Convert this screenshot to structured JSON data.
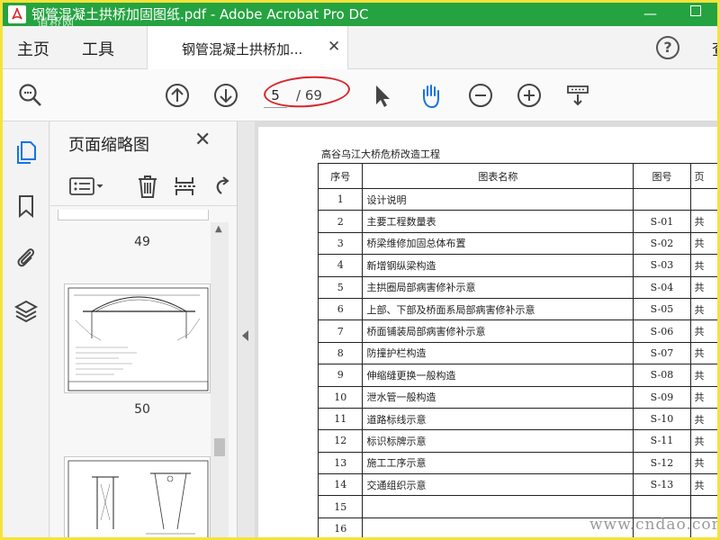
{
  "window": {
    "title": "钢管混凝土拱桥加固图纸.pdf - Adobe Acrobat Pro DC",
    "watermark": "道桥网",
    "minimize": "—",
    "maximize": ""
  },
  "menu": {
    "home": "主页",
    "tools": "工具",
    "doc_tab": "钢管混凝土拱桥加...",
    "tab_close": "✕",
    "help": "?",
    "cutoff": "查"
  },
  "toolbar": {
    "current_page": "5",
    "total_pages": "/ 69",
    "icons": [
      "zoom-search-icon",
      "page-up-icon",
      "page-down-icon",
      "select-arrow-icon",
      "hand-tool-icon",
      "zoom-out-icon",
      "zoom-in-icon",
      "marquee-zoom-icon"
    ],
    "hand_color": "#1473e6",
    "ellipse_color": "#d9262b"
  },
  "thumbnails": {
    "panel_title": "页面缩略图",
    "close": "✕",
    "pages": [
      {
        "number": "49"
      },
      {
        "number": "50"
      }
    ]
  },
  "document": {
    "heading": "高谷乌江大桥危桥改造工程",
    "headers": [
      "序号",
      "图表名称",
      "图号",
      "页"
    ],
    "rows": [
      [
        "1",
        "设计说明",
        "",
        ""
      ],
      [
        "2",
        "主要工程数量表",
        "S-01",
        "共"
      ],
      [
        "3",
        "桥梁维修加固总体布置",
        "S-02",
        "共"
      ],
      [
        "4",
        "新增钢纵梁构造",
        "S-03",
        "共"
      ],
      [
        "5",
        "主拱圈局部病害修补示意",
        "S-04",
        "共"
      ],
      [
        "6",
        "上部、下部及桥面系局部病害修补示意",
        "S-05",
        "共"
      ],
      [
        "7",
        "桥面铺装局部病害修补示意",
        "S-06",
        "共"
      ],
      [
        "8",
        "防撞护栏构造",
        "S-07",
        "共"
      ],
      [
        "9",
        "伸缩缝更换一般构造",
        "S-08",
        "共"
      ],
      [
        "10",
        "泄水管一般构造",
        "S-09",
        "共"
      ],
      [
        "11",
        "道路标线示意",
        "S-10",
        "共"
      ],
      [
        "12",
        "标识标牌示意",
        "S-11",
        "共"
      ],
      [
        "13",
        "施工工序示意",
        "S-12",
        "共"
      ],
      [
        "14",
        "交通组织示意",
        "S-13",
        "共"
      ],
      [
        "15",
        "",
        "",
        ""
      ],
      [
        "16",
        "",
        "",
        ""
      ]
    ]
  },
  "site_watermark": "www.cndao.com",
  "colors": {
    "titlebar": "#25a340",
    "frame": "#f5e33a"
  }
}
